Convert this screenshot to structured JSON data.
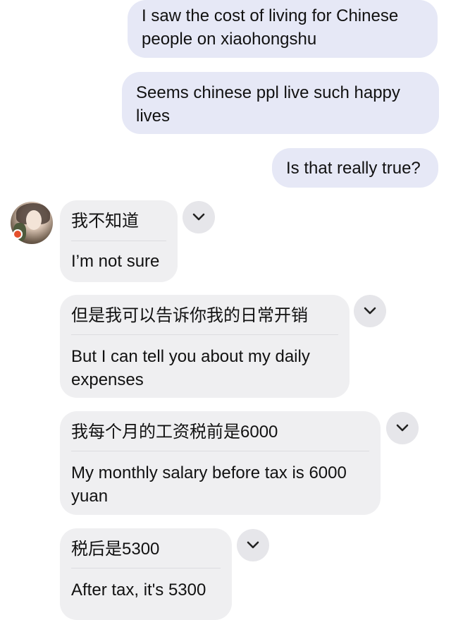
{
  "sent_messages": [
    {
      "text": "I saw the cost of living for Chinese people on xiaohongshu"
    },
    {
      "text": "Seems chinese ppl live such happy lives"
    },
    {
      "text": "Is that really true?"
    }
  ],
  "received_messages": [
    {
      "chinese": "我不知道",
      "english": "I’m not sure"
    },
    {
      "chinese": "但是我可以告诉你我的日常开销",
      "english": "But I can tell you about my daily expenses"
    },
    {
      "chinese": "我每个月的工资税前是6000",
      "english": "My monthly salary before tax is 6000 yuan"
    },
    {
      "chinese": "税后是5300",
      "english": "After tax, it's 5300"
    }
  ],
  "colors": {
    "sent_bubble": "#e6e8f6",
    "received_bubble": "#efeff1",
    "status_dot": "#e5502c"
  },
  "icons": {
    "translate_toggle": "chevron-down-icon",
    "avatar": "avatar"
  }
}
